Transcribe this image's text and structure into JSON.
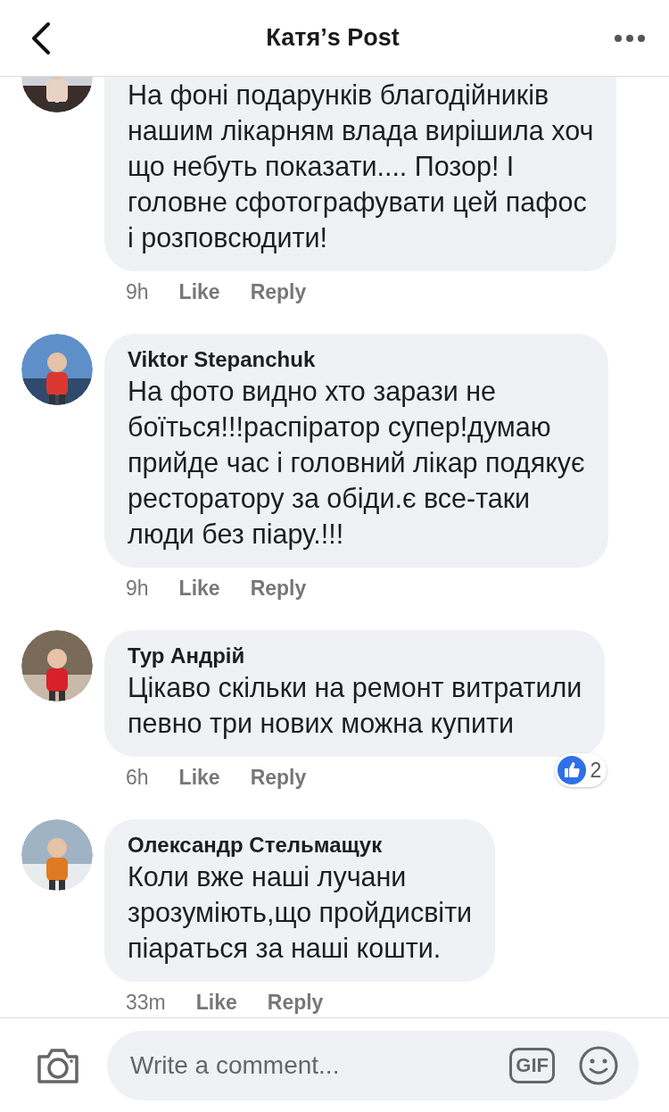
{
  "header": {
    "title": "Катя’s Post"
  },
  "comments": [
    {
      "text": "На фоні подарунків благодійників\nнашим лікарням влада вирішила хоч\nщо небуть показати.... Позор! І\nголовне сфотографувати цей пафос\nі розповсюдити!",
      "time": "9h",
      "like": "Like",
      "reply": "Reply"
    },
    {
      "author": "Viktor Stepanchuk",
      "text": "На фото видно хто зарази не\nбоїться!!!распіратор супер!думаю\nприйде час і головний лікар подякує\nресторатору за обіди.є все-таки\nлюди без піару.!!!",
      "time": "9h",
      "like": "Like",
      "reply": "Reply"
    },
    {
      "author": "Тур Андрій",
      "text": "Цікаво скільки на ремонт витратили\nпевно три нових можна купити",
      "time": "6h",
      "like": "Like",
      "reply": "Reply",
      "reactions": "2"
    },
    {
      "author": "Олександр Стельмащук",
      "text": "Коли вже наші лучани\nзрозуміють,що пройдисвіти\nпіараться за наші кошти.",
      "time": "33m",
      "like": "Like",
      "reply": "Reply"
    }
  ],
  "composer": {
    "placeholder": "Write a comment...",
    "gif": "GIF"
  }
}
